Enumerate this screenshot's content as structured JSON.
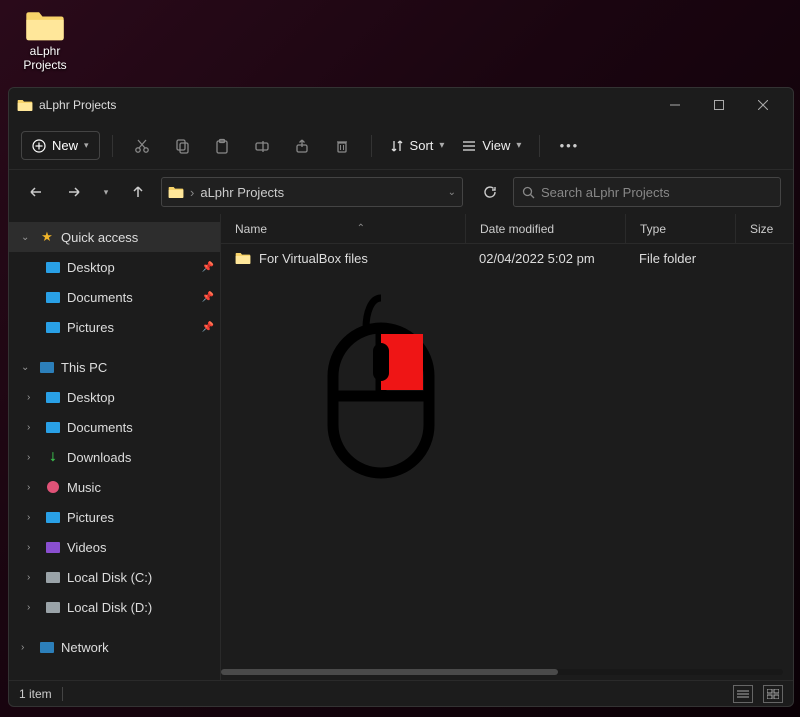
{
  "desktop": {
    "folder_label": "aLphr Projects"
  },
  "window": {
    "title": "aLphr Projects"
  },
  "toolbar": {
    "new_label": "New",
    "sort_label": "Sort",
    "view_label": "View"
  },
  "address": {
    "crumb": "aLphr Projects"
  },
  "search": {
    "placeholder": "Search aLphr Projects"
  },
  "columns": {
    "name": "Name",
    "date": "Date modified",
    "type": "Type",
    "size": "Size"
  },
  "rows": [
    {
      "name": "For VirtualBox files",
      "date": "02/04/2022 5:02 pm",
      "type": "File folder",
      "size": ""
    }
  ],
  "sidebar": {
    "quick_access": "Quick access",
    "items_qa": [
      {
        "label": "Desktop",
        "color": "#29a0e6"
      },
      {
        "label": "Documents",
        "color": "#29a0e6"
      },
      {
        "label": "Pictures",
        "color": "#29a0e6"
      }
    ],
    "this_pc": "This PC",
    "items_pc": [
      {
        "label": "Desktop",
        "color": "#29a0e6"
      },
      {
        "label": "Documents",
        "color": "#29a0e6"
      },
      {
        "label": "Downloads",
        "color": "#39b34a"
      },
      {
        "label": "Music",
        "color": "#e05277"
      },
      {
        "label": "Pictures",
        "color": "#29a0e6"
      },
      {
        "label": "Videos",
        "color": "#8a4fd0"
      },
      {
        "label": "Local Disk (C:)",
        "color": "#9aa3a8"
      },
      {
        "label": "Local Disk (D:)",
        "color": "#9aa3a8"
      }
    ],
    "network": "Network"
  },
  "status": {
    "count": "1 item"
  }
}
